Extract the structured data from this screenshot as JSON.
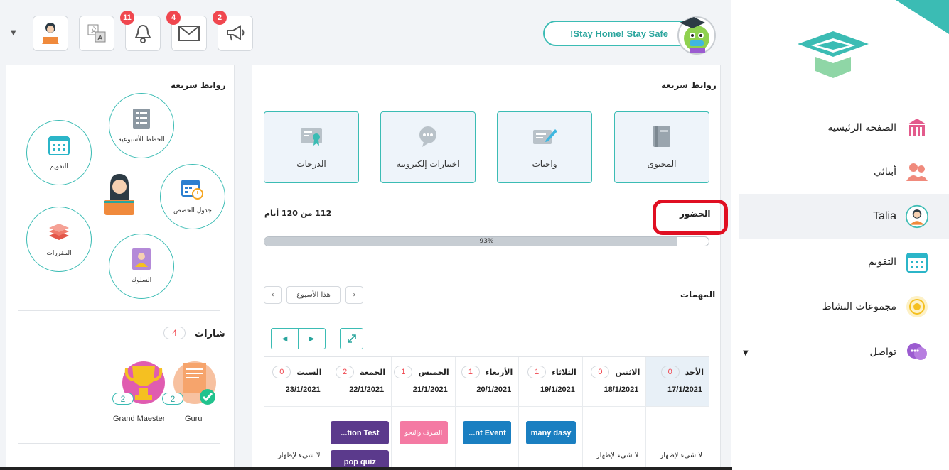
{
  "header": {
    "stay_home": "!Stay Home! Stay Safe",
    "notifications_badge": "11",
    "messages_badge": "4",
    "announcements_badge": "2",
    "icons": [
      "user-avatar-icon",
      "translate-icon",
      "bell-icon",
      "mail-icon",
      "megaphone-icon"
    ]
  },
  "sidebar": {
    "items": [
      {
        "label": "الصفحة الرئيسية",
        "icon": "home-icon"
      },
      {
        "label": "أبنائي",
        "icon": "children-icon"
      },
      {
        "label": "Talia",
        "icon": "student-avatar-icon"
      },
      {
        "label": "التقويم",
        "icon": "calendar-icon"
      },
      {
        "label": "مجموعات النشاط",
        "icon": "activity-groups-icon"
      },
      {
        "label": "تواصل",
        "icon": "chat-icon"
      }
    ]
  },
  "main": {
    "quick_links_title": "روابط سريعة",
    "quick_links": [
      {
        "label": "المحتوى",
        "icon": "book-icon"
      },
      {
        "label": "واجبات",
        "icon": "homework-icon"
      },
      {
        "label": "اختبارات إلكترونية",
        "icon": "quiz-icon"
      },
      {
        "label": "الدرجات",
        "icon": "certificate-icon"
      }
    ],
    "attendance": {
      "title": "الحضور",
      "summary": "112 من 120 أيام",
      "percent_label": "93%",
      "percent": 93
    },
    "tasks": {
      "title": "المهمات",
      "this_week": "هذا الأسبوع",
      "days": [
        {
          "day": "الأحد",
          "count": "0",
          "date": "17/1/2021",
          "empty": "لا شيء لإظهار",
          "events": []
        },
        {
          "day": "الاثنين",
          "count": "0",
          "date": "18/1/2021",
          "empty": "لا شيء لإظهار",
          "events": []
        },
        {
          "day": "الثلاثاء",
          "count": "1",
          "date": "19/1/2021",
          "empty": "",
          "events": [
            {
              "label": "many dasy",
              "color": "#1a7fc1"
            }
          ]
        },
        {
          "day": "الأربعاء",
          "count": "1",
          "date": "20/1/2021",
          "empty": "",
          "events": [
            {
              "label": "...nt Event",
              "color": "#1a7fc1"
            }
          ]
        },
        {
          "day": "الخميس",
          "count": "1",
          "date": "21/1/2021",
          "empty": "",
          "events": [
            {
              "label": "الصرف والنحو",
              "color": "#f47aa3"
            }
          ]
        },
        {
          "day": "الجمعة",
          "count": "2",
          "date": "22/1/2021",
          "empty": "",
          "events": [
            {
              "label": "...tion Test",
              "color": "#5b3a8c"
            },
            {
              "label": "pop quiz",
              "color": "#5b3a8c"
            }
          ]
        },
        {
          "day": "السبت",
          "count": "0",
          "date": "23/1/2021",
          "empty": "لا شيء لإظهار",
          "events": []
        }
      ]
    }
  },
  "left": {
    "quick_links_title": "روابط سريعة",
    "bubbles": [
      {
        "label": "الخطط الأسبوعية",
        "icon": "weekly-plan-icon"
      },
      {
        "label": "التقويم",
        "icon": "calendar-icon"
      },
      {
        "label": "جدول الحصص",
        "icon": "timetable-icon"
      },
      {
        "label": "المقررات",
        "icon": "courses-icon"
      },
      {
        "label": "السلوك",
        "icon": "behavior-icon"
      }
    ],
    "badges_title": "شارات",
    "badges_count": "4",
    "achievements": [
      {
        "name": "Guru",
        "count": "2"
      },
      {
        "name": "Grand Maester",
        "count": "2"
      }
    ]
  },
  "colors": {
    "accent": "#3bbcb4",
    "badge_red": "#f0474f",
    "attendance_ring": "#e00f22"
  }
}
